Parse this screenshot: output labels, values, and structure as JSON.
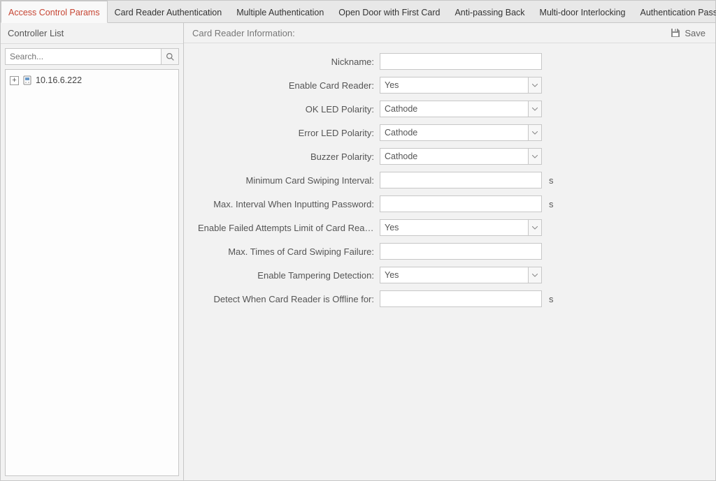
{
  "tabs": [
    {
      "label": "Access Control Params",
      "active": true
    },
    {
      "label": "Card Reader Authentication"
    },
    {
      "label": "Multiple Authentication"
    },
    {
      "label": "Open Door with First Card"
    },
    {
      "label": "Anti-passing Back"
    },
    {
      "label": "Multi-door Interlocking"
    },
    {
      "label": "Authentication Password"
    }
  ],
  "sidebar": {
    "title": "Controller List",
    "search_placeholder": "Search...",
    "items": [
      {
        "label": "10.16.6.222"
      }
    ]
  },
  "main": {
    "title": "Card Reader Information:",
    "save_label": "Save",
    "fields": {
      "nickname": {
        "label": "Nickname:",
        "value": ""
      },
      "enable_reader": {
        "label": "Enable Card Reader:",
        "value": "Yes"
      },
      "ok_led": {
        "label": "OK LED Polarity:",
        "value": "Cathode"
      },
      "error_led": {
        "label": "Error LED Polarity:",
        "value": "Cathode"
      },
      "buzzer": {
        "label": "Buzzer Polarity:",
        "value": "Cathode"
      },
      "min_swipe": {
        "label": "Minimum Card Swiping Interval:",
        "value": "",
        "unit": "s"
      },
      "max_pwd_interval": {
        "label": "Max. Interval When Inputting Password:",
        "value": "",
        "unit": "s"
      },
      "enable_failed": {
        "label": "Enable Failed Attempts Limit of Card Readi...",
        "value": "Yes"
      },
      "max_swipe_fail": {
        "label": "Max. Times of Card Swiping Failure:",
        "value": ""
      },
      "tampering": {
        "label": "Enable Tampering Detection:",
        "value": "Yes"
      },
      "offline": {
        "label": "Detect When Card Reader is Offline for:",
        "value": "",
        "unit": "s"
      }
    }
  }
}
